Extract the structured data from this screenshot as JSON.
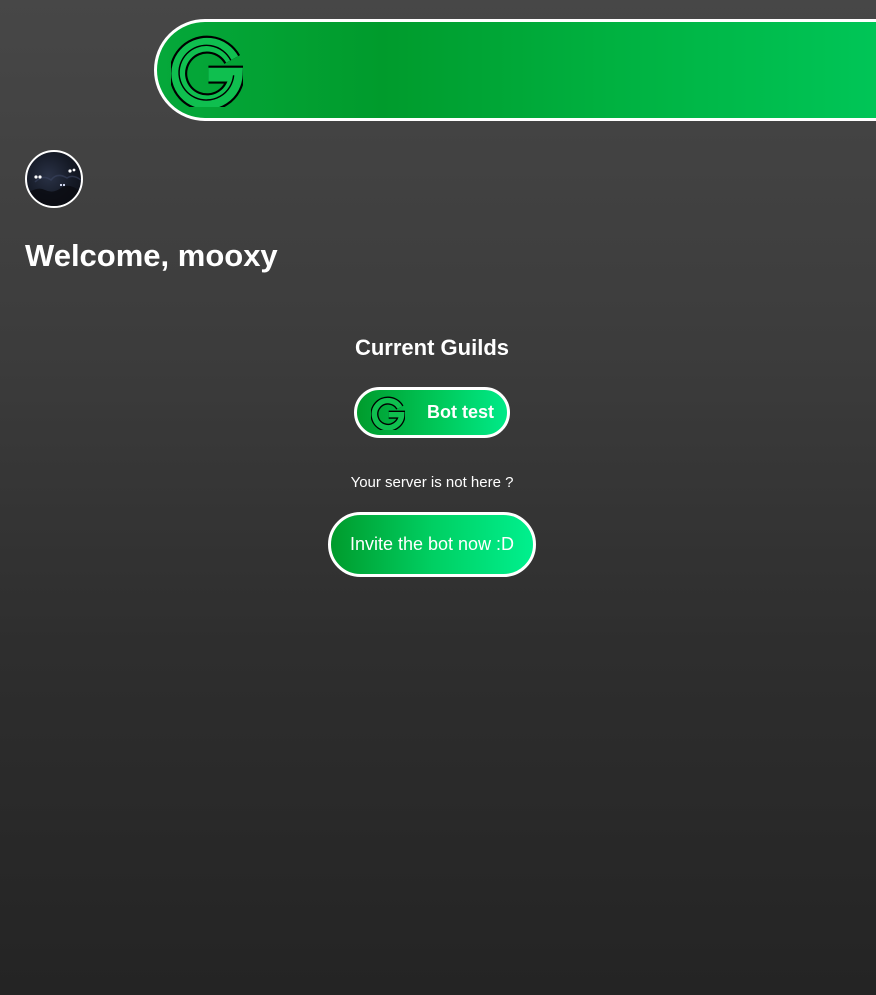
{
  "header": {
    "logo_icon": "g-logo-icon"
  },
  "user": {
    "avatar": "user-avatar",
    "welcome_text": "Welcome, mooxy"
  },
  "guilds": {
    "title": "Current Guilds",
    "items": [
      {
        "name": "Bot test",
        "icon": "g-logo-icon"
      }
    ]
  },
  "invite": {
    "notice": "Your server is not here ?",
    "button_label": "Invite the bot now :D"
  },
  "colors": {
    "accent_green": "#00b140",
    "light_green": "#00ea88",
    "dark_green": "#009b2c",
    "background_top": "#474747",
    "background_bottom": "#242424",
    "border": "#ffffff"
  }
}
